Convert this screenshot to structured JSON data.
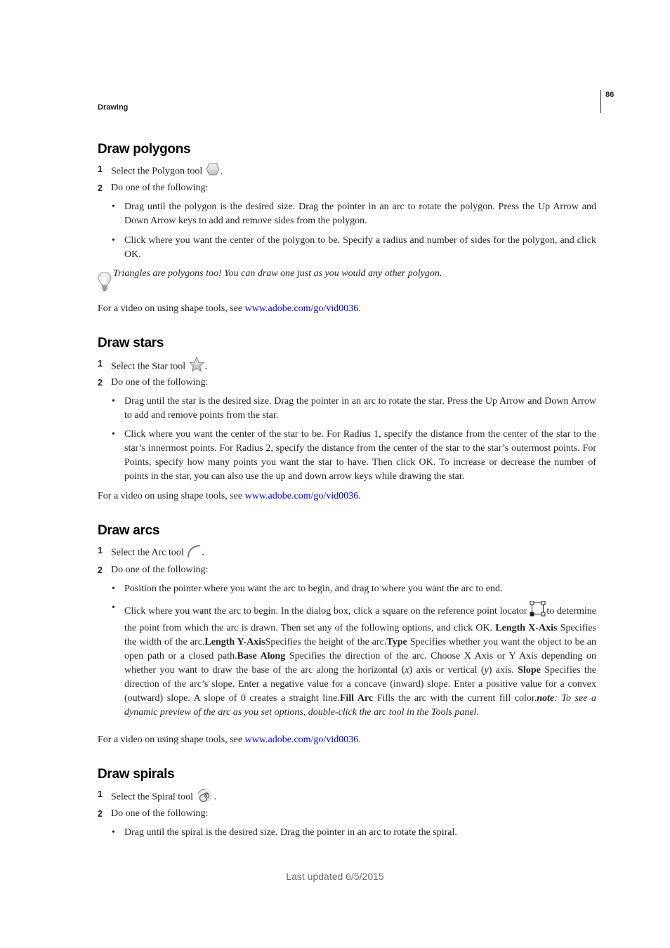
{
  "header": {
    "running_head": "Drawing",
    "page_number": "86"
  },
  "video_prefix": "For a video on using shape tools, see ",
  "video_link": "www.adobe.com/go/vid0036",
  "video_suffix": ".",
  "sections": {
    "polygons": {
      "title": "Draw polygons",
      "step1_num": "1",
      "step1_text": "Select the Polygon tool",
      "step1_icon": "polygon-tool-icon",
      "step2_num": "2",
      "step2_text": "Do one of the following:",
      "bullets": [
        "Drag until the polygon is the desired size. Drag the pointer in an arc to rotate the polygon. Press the Up Arrow and Down Arrow keys to add and remove sides from the polygon.",
        "Click where you want the center of the polygon to be. Specify a radius and number of sides for the polygon, and click OK."
      ],
      "tip": "Triangles are polygons too! You can draw one just as you would any other polygon."
    },
    "stars": {
      "title": "Draw stars",
      "step1_num": "1",
      "step1_text": "Select the Star tool",
      "step1_icon": "star-tool-icon",
      "step2_num": "2",
      "step2_text": "Do one of the following:",
      "bullets": [
        "Drag until the star is the desired size. Drag the pointer in an arc to rotate the star. Press the Up Arrow and Down Arrow to add and remove points from the star.",
        "Click where you want the center of the star to be. For Radius 1, specify the distance from the center of the star to the star’s innermost points. For Radius 2, specify the distance from the center of the star to the star’s outermost points. For Points, specify how many points you want the star to have. Then click OK. To increase or decrease the number of points in the star, you can also use the up and down arrow keys while drawing the star."
      ]
    },
    "arcs": {
      "title": "Draw arcs",
      "step1_num": "1",
      "step1_text": "Select the Arc tool",
      "step1_icon": "arc-tool-icon",
      "step2_num": "2",
      "step2_text": "Do one of the following:",
      "bullet1": "Position the pointer where you want the arc to begin, and drag to where you want the arc to end.",
      "bullet2": {
        "intro": "Click where you want the arc to begin. In the dialog box, click a square on the reference point locator",
        "after_icon": "to determine the point from which the arc is drawn. Then set any of the following options, and click OK.",
        "length_x_label": "Length X-Axis",
        "length_x_text": " Specifies the width of the arc.",
        "length_y_label": "Length Y-Axis",
        "length_y_text": "Specifies the height of the arc.",
        "type_label": "Type",
        "type_text": " Specifies whether you want the object to be an open path or a closed path.",
        "base_label": "Base Along",
        "base_text_1": " Specifies the direction of the arc. Choose X Axis or Y Axis depending on whether you want to draw the base of the arc along the horizontal (",
        "x_var": "x",
        "base_text_2": ") axis or vertical (",
        "y_var": "y",
        "base_text_3": ") axis. ",
        "slope_label": "Slope",
        "slope_text": " Specifies the direction of the arc’s slope. Enter a negative value for a concave (inward) slope. Enter a positive value for a convex (outward) slope. A slope of 0 creates a straight line.",
        "fill_label": "Fill Arc",
        "fill_text": " Fills the arc with the current fill color.",
        "note_label": "note",
        "note_text": ": To see a dynamic preview of the arc as you set options, double-click the arc tool in the Tools panel."
      }
    },
    "spirals": {
      "title": "Draw spirals",
      "step1_num": "1",
      "step1_text": "Select the Spiral tool",
      "step1_icon": "spiral-tool-icon",
      "step2_num": "2",
      "step2_text": "Do one of the following:",
      "bullets": [
        "Drag until the spiral is the desired size. Drag the pointer in an arc to rotate the spiral."
      ]
    }
  },
  "footer": {
    "last_updated": "Last updated 6/5/2015"
  }
}
